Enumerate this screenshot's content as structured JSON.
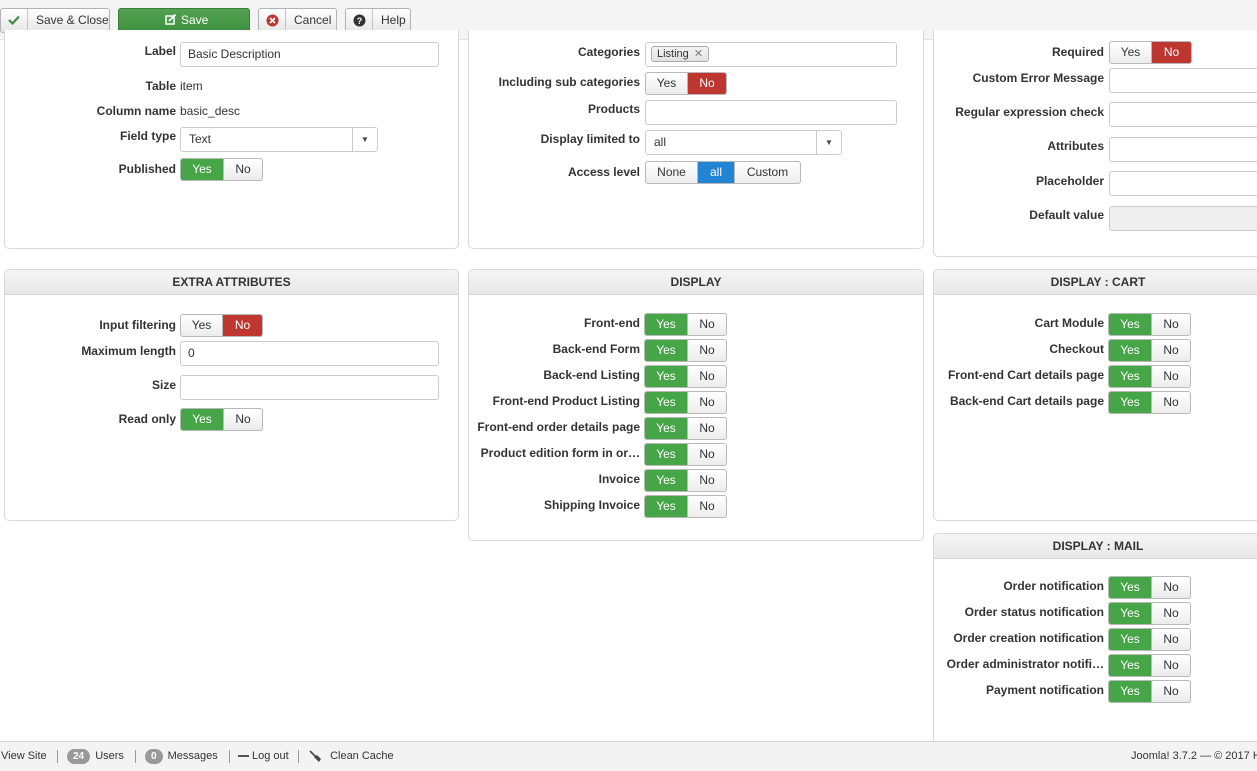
{
  "toolbar": {
    "save_close": "Save & Close",
    "save": "Save",
    "cancel": "Cancel",
    "help": "Help"
  },
  "general": {
    "label_label": "Label",
    "label_value": "Basic Description",
    "table_label": "Table",
    "table_value": "item",
    "column_label": "Column name",
    "column_value": "basic_desc",
    "fieldtype_label": "Field type",
    "fieldtype_value": "Text",
    "published_label": "Published"
  },
  "restrictions": {
    "categories_label": "Categories",
    "categories_tag": "Listing",
    "subcat_label": "Including sub categories",
    "products_label": "Products",
    "limited_label": "Display limited to",
    "limited_value": "all",
    "access_label": "Access level",
    "access_options": [
      "None",
      "all",
      "Custom"
    ],
    "access_selected": "all"
  },
  "validation": {
    "required_label": "Required",
    "error_label": "Custom Error Message",
    "regex_label": "Regular expression check",
    "attributes_label": "Attributes",
    "placeholder_label": "Placeholder",
    "default_label": "Default value"
  },
  "yes": "Yes",
  "no": "No",
  "extra": {
    "title": "EXTRA ATTRIBUTES",
    "input_filtering": "Input filtering",
    "max_length": "Maximum length",
    "max_length_value": "0",
    "size": "Size",
    "read_only": "Read only"
  },
  "display": {
    "title": "DISPLAY",
    "rows": [
      "Front-end",
      "Back-end Form",
      "Back-end Listing",
      "Front-end Product Listing",
      "Front-end order details page",
      "Product edition form in or…",
      "Invoice",
      "Shipping Invoice"
    ]
  },
  "display_cart": {
    "title": "DISPLAY : CART",
    "rows": [
      "Cart Module",
      "Checkout",
      "Front-end Cart details page",
      "Back-end Cart details page"
    ]
  },
  "display_mail": {
    "title": "DISPLAY : MAIL",
    "rows": [
      "Order notification",
      "Order status notification",
      "Order creation notification",
      "Order administrator notifi…",
      "Payment notification"
    ]
  },
  "footer": {
    "view_site": "View Site",
    "users_count": "24",
    "users_label": "Users",
    "messages_count": "0",
    "messages_label": "Messages",
    "logout": "Log out",
    "clean_cache": "Clean Cache",
    "version": "Joomla! 3.7.2  —  © 2017 H"
  },
  "colors": {
    "yes_on": "#46a546",
    "no_on": "#bd362f",
    "selected_blue": "#2384d3"
  }
}
